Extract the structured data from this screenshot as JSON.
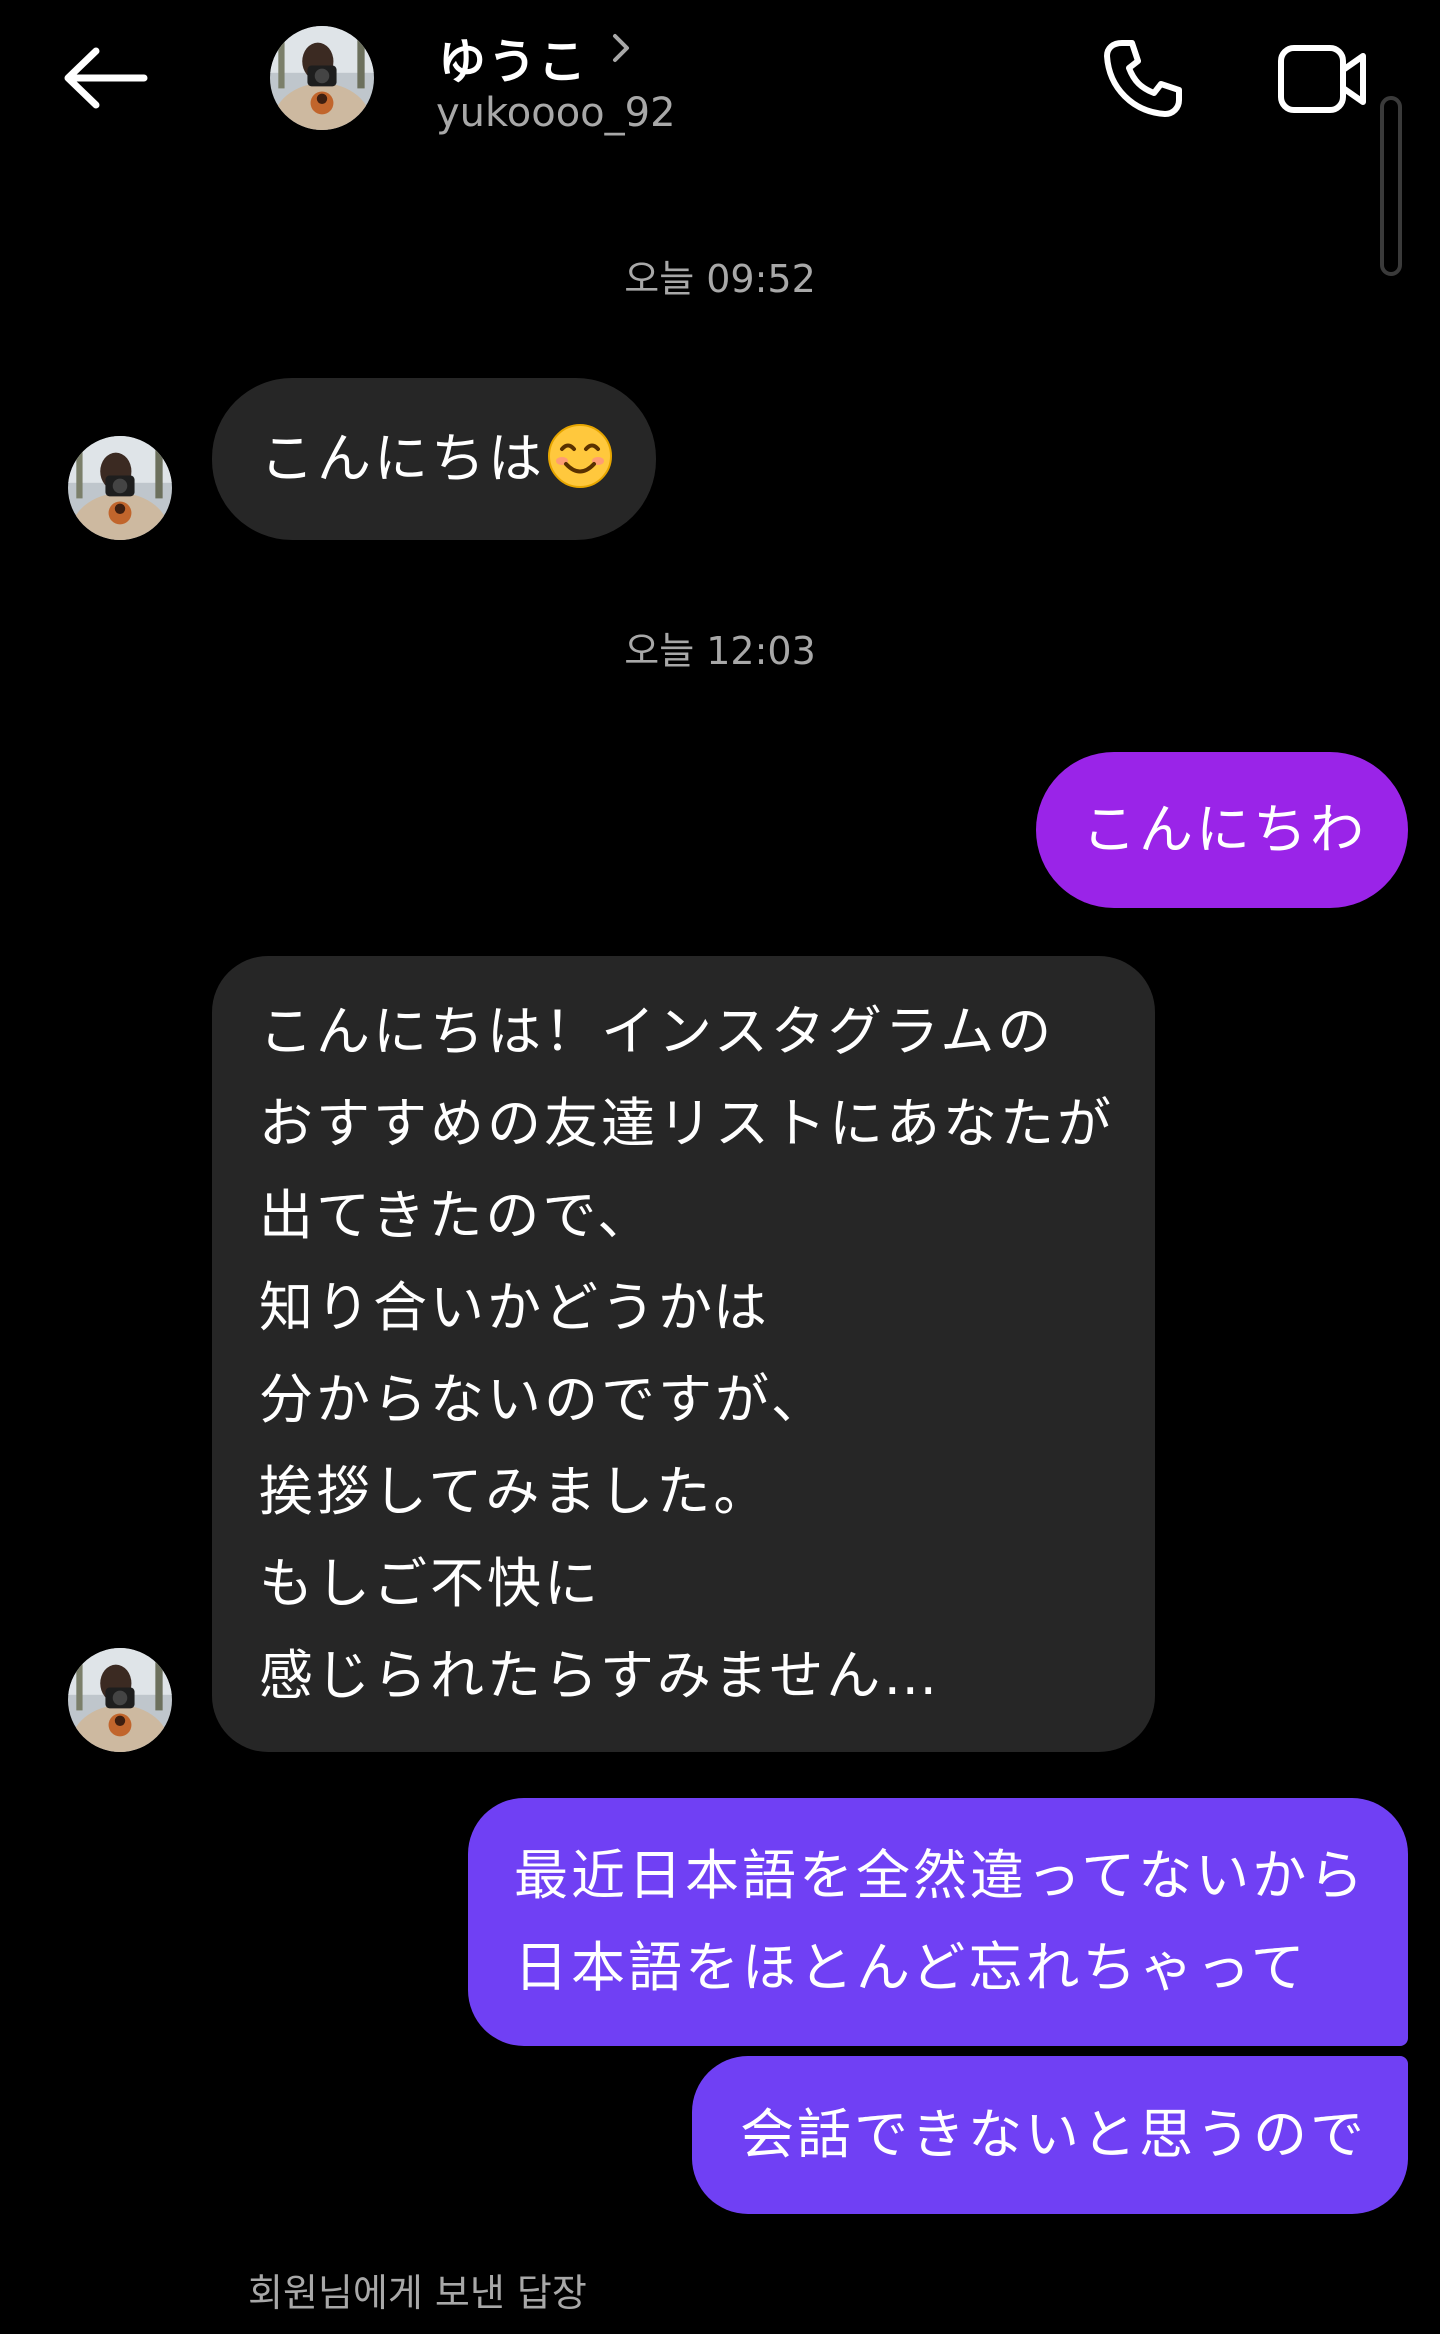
{
  "header": {
    "name": "ゆうこ",
    "username": "yukoooo_92"
  },
  "timestamps": {
    "first": "오늘 09:52",
    "second": "오늘 12:03"
  },
  "messages": {
    "in_greeting": "こんにちは",
    "out_greeting": "こんにちわ",
    "in_long": [
      "こんにちは！インスタグラムの",
      "おすすめの友達リストにあなたが",
      "出てきたので、",
      "知り合いかどうかは",
      "分からないのですが、",
      "挨拶してみました。",
      "もしご不快に",
      "感じられたらすみません…"
    ],
    "out_lines": [
      "最近日本語を全然違ってないから",
      "日本語をほとんど忘れちゃって"
    ],
    "out_last": "会話できないと思うので"
  },
  "footer": {
    "reply_note": "회원님에게 보낸 답장"
  },
  "icons": {
    "back": "arrow-left-icon",
    "call": "phone-icon",
    "video": "video-camera-icon",
    "chevron": "chevron-right-icon",
    "emoji": "smiling-face-emoji"
  },
  "colors": {
    "background": "#000000",
    "incoming_bubble": "#262626",
    "outgoing_magenta": "#9a24e8",
    "outgoing_violet": "#7040f4",
    "secondary_text": "#a8a8a8"
  }
}
